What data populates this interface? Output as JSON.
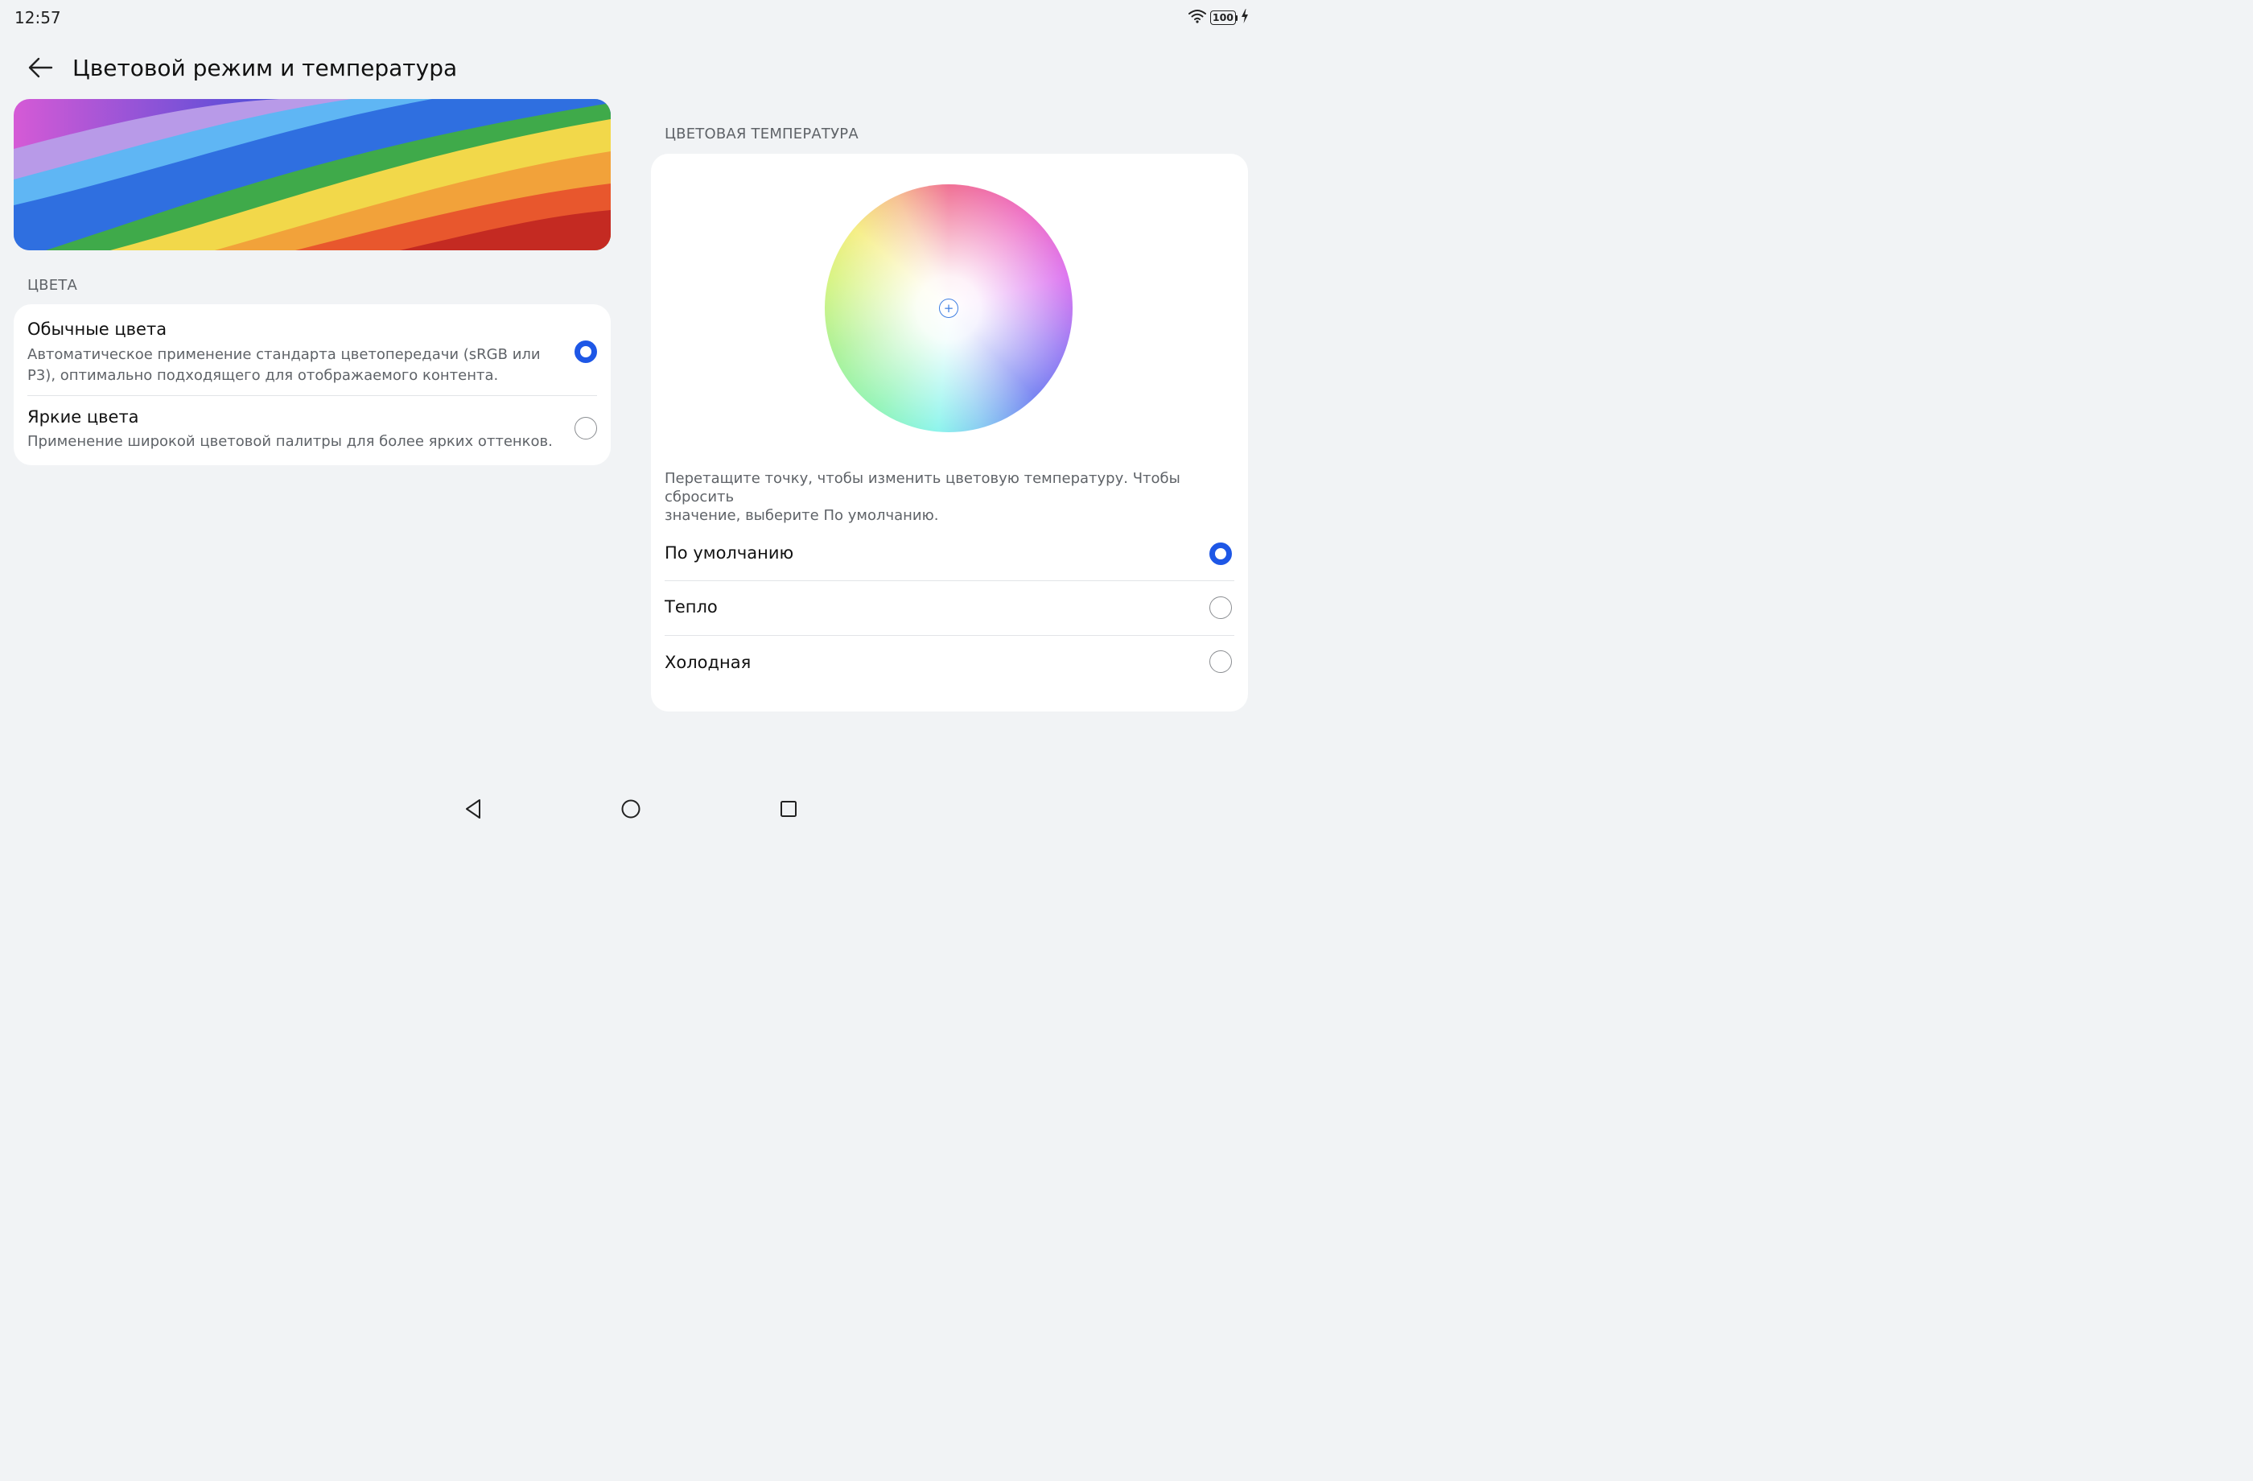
{
  "status_bar": {
    "time": "12:57",
    "battery": "100",
    "icons": [
      "wifi-icon",
      "battery-icon",
      "charging-icon"
    ]
  },
  "header": {
    "title": "Цветовой режим и температура",
    "back_icon": "back-arrow-icon"
  },
  "colors_section": {
    "label": "ЦВЕТА",
    "options": [
      {
        "title": "Обычные цвета",
        "description_line1": "Автоматическое применение стандарта цветопередачи (sRGB или",
        "description_line2": "P3), оптимально подходящего для отображаемого контента.",
        "selected": true
      },
      {
        "title": "Яркие цвета",
        "description_line1": "Применение широкой цветовой палитры для более ярких оттенков.",
        "selected": false
      }
    ]
  },
  "temperature_section": {
    "label": "ЦВЕТОВАЯ ТЕМПЕРАТУРА",
    "handle_symbol": "+",
    "hint_line1": "Перетащите точку, чтобы изменить цветовую температуру. Чтобы сбросить",
    "hint_line2": "значение, выберите По умолчанию.",
    "options": [
      {
        "label": "По умолчанию",
        "selected": true
      },
      {
        "label": "Тепло",
        "selected": false
      },
      {
        "label": "Холодная",
        "selected": false
      }
    ]
  },
  "nav_bar": {
    "buttons": [
      "back-triangle-icon",
      "home-circle-icon",
      "recents-square-icon"
    ]
  },
  "theme": {
    "accent": "#1e57e6",
    "background": "#f1f3f5",
    "card": "#ffffff",
    "secondary_text": "#5f6368"
  }
}
